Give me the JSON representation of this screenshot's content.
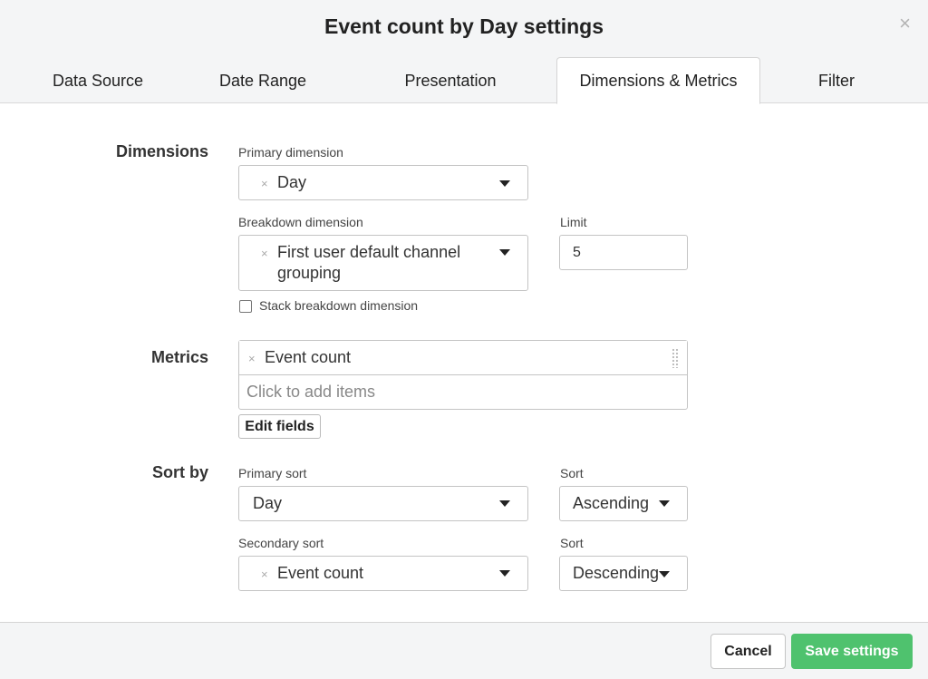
{
  "dialog": {
    "title": "Event count by Day settings",
    "close_icon": "×"
  },
  "tabs": [
    {
      "label": "Data Source"
    },
    {
      "label": "Date Range"
    },
    {
      "label": "Presentation"
    },
    {
      "label": "Dimensions & Metrics",
      "active": true
    },
    {
      "label": "Filter"
    }
  ],
  "dimensions": {
    "section_label": "Dimensions",
    "primary_label": "Primary dimension",
    "primary_value": "Day",
    "breakdown_label": "Breakdown dimension",
    "breakdown_value_line1": "First user default channel",
    "breakdown_value_line2": "grouping",
    "limit_label": "Limit",
    "limit_value": "5",
    "stack_label": "Stack breakdown dimension",
    "stack_checked": false
  },
  "metrics": {
    "section_label": "Metrics",
    "items": [
      {
        "label": "Event count"
      }
    ],
    "add_placeholder": "Click to add items",
    "edit_fields_label": "Edit fields"
  },
  "sort": {
    "section_label": "Sort by",
    "primary_label": "Primary sort",
    "primary_value": "Day",
    "primary_order_label": "Sort",
    "primary_order_value": "Ascending",
    "secondary_label": "Secondary sort",
    "secondary_value": "Event count",
    "secondary_order_label": "Sort",
    "secondary_order_value": "Descending"
  },
  "footer": {
    "cancel_label": "Cancel",
    "save_label": "Save settings"
  },
  "colors": {
    "save_button": "#4fc26e",
    "header_bg": "#f4f5f6"
  },
  "icons": {
    "remove": "×",
    "dropdown": "chevron-down-icon",
    "drag": "drag-handle-icon"
  }
}
